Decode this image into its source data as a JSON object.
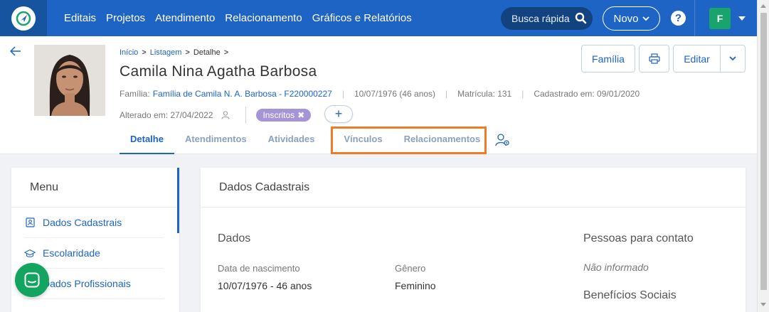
{
  "nav": {
    "items": [
      "Editais",
      "Projetos",
      "Atendimento",
      "Relacionamento",
      "Gráficos e Relatórios"
    ],
    "search_label": "Busca rápida",
    "novo_label": "Novo",
    "help_label": "?",
    "avatar_initial": "F"
  },
  "header": {
    "breadcrumb": {
      "inicio": "Início",
      "listagem": "Listagem",
      "detalhe": "Detalhe",
      "sep": ">"
    },
    "name": "Camila Nina Agatha Barbosa",
    "familia_label": "Família:",
    "familia_value": "Família de Camila N. A. Barbosa - F220000227",
    "birth": "10/07/1976 (46 anos)",
    "matricula": "Matrícula: 131",
    "cadastrado": "Cadastrado em: 09/01/2020",
    "alterado": "Alterado em: 27/04/2022",
    "tag": "Inscritos",
    "tag_remove": "✖",
    "add_label": "+",
    "buttons": {
      "familia": "Família",
      "editar": "Editar"
    }
  },
  "tabs": [
    "Detalhe",
    "Atendimentos",
    "Atividades",
    "Vínculos",
    "Relacionamentos"
  ],
  "menu": {
    "title": "Menu",
    "items": [
      "Dados Cadastrais",
      "Escolaridade",
      "Dados Profissionais"
    ]
  },
  "main": {
    "section_title": "Dados Cadastrais",
    "dados_title": "Dados",
    "nasc_label": "Data de nascimento",
    "nasc_value": "10/07/1976 - 46 anos",
    "genero_label": "Gênero",
    "genero_value": "Feminino",
    "contato_title": "Pessoas para contato",
    "contato_value": "Não informado",
    "beneficios_title": "Benefícios Sociais"
  },
  "colors": {
    "primary": "#1d64c4",
    "nav_dark": "#17549f",
    "tag": "#a594d6",
    "highlight": "#ef7b26",
    "chat": "#13a460",
    "avatar": "#1aa46d"
  }
}
